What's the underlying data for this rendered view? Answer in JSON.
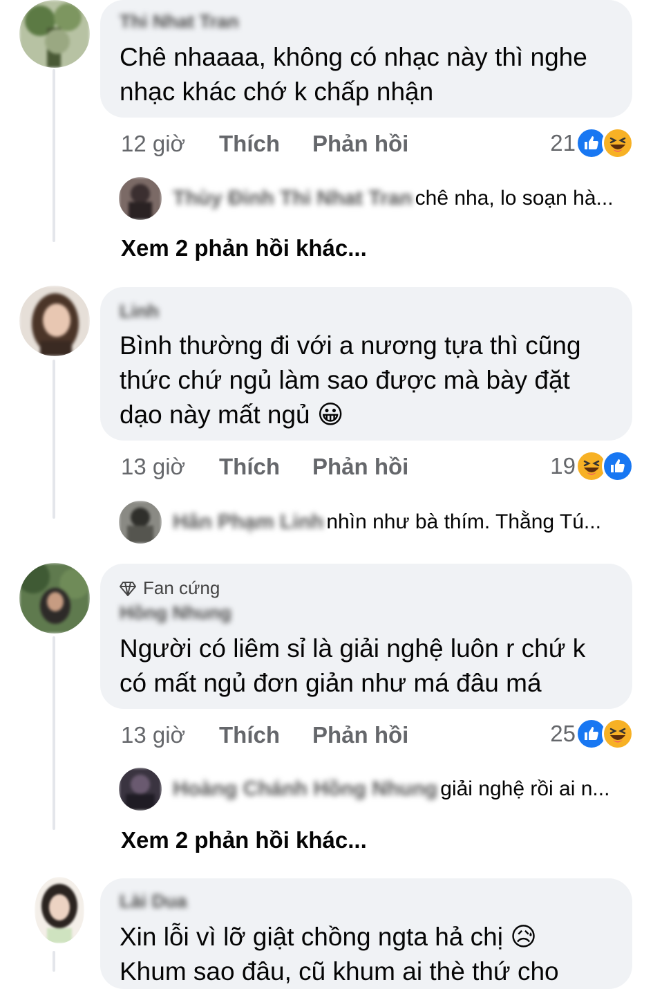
{
  "colors": {
    "bubble": "#f0f2f5",
    "meta_text": "#65676b",
    "like_blue": "#1877f2",
    "haha_yellow": "#f7b125"
  },
  "comments": [
    {
      "author": "Thi Nhat Tran",
      "text": "Chê nhaaaa, không có nhạc này thì nghe nhạc khác chớ k chấp nhận",
      "time": "12 giờ",
      "like_label": "Thích",
      "reply_label": "Phản hồi",
      "reaction_count": "21",
      "reactions": [
        "like-icon",
        "haha-icon"
      ],
      "reply": {
        "names": "Thùy Đinh Thi Nhat Tran",
        "text": "chê nha, lo soạn hà..."
      },
      "more_replies": "Xem 2 phản hồi khác..."
    },
    {
      "author": "Linh",
      "text": "Bình thường đi với a nương tựa thì cũng thức chứ ngủ làm sao được mà bày đặt dạo này mất ngủ 😀",
      "time": "13 giờ",
      "like_label": "Thích",
      "reply_label": "Phản hồi",
      "reaction_count": "19",
      "reactions": [
        "haha-icon",
        "like-icon"
      ],
      "reply": {
        "names": "Hân Phạm Linh",
        "text": "nhìn như bà thím. Thằng Tú..."
      }
    },
    {
      "badge": "Fan cứng",
      "author": "Hồng Nhung",
      "text": "Người có liêm sỉ là giải nghệ luôn r chứ k có mất ngủ đơn giản như má đâu má",
      "time": "13 giờ",
      "like_label": "Thích",
      "reply_label": "Phản hồi",
      "reaction_count": "25",
      "reactions": [
        "like-icon",
        "haha-icon"
      ],
      "reply": {
        "names": "Hoàng Chánh Hồng Nhung",
        "text": "giải nghệ rồi ai n..."
      },
      "more_replies": "Xem 2 phản hồi khác..."
    },
    {
      "author": "Lài Dua",
      "text": "Xin lỗi vì lỡ giật chồng ngta hả chị 😥",
      "text_cut": "Khum sao đâu, cũ khum ai thè thứ cho"
    }
  ]
}
